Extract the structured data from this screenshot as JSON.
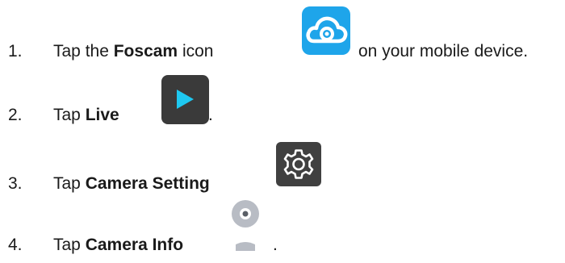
{
  "steps": [
    {
      "number": "1.",
      "prefix": "Tap the ",
      "bold": "Foscam",
      "suffix": " icon",
      "after_icon": "on your mobile device.",
      "icon": "foscam-cloud-app-icon"
    },
    {
      "number": "2.",
      "prefix": "Tap ",
      "bold": "Live",
      "after_icon": ".",
      "icon": "play-icon"
    },
    {
      "number": "3.",
      "prefix": "Tap ",
      "bold": "Camera Setting",
      "icon": "gear-icon"
    },
    {
      "number": "4.",
      "prefix": "Tap ",
      "bold": "Camera Info",
      "after_icon": ".",
      "icon": "camera-icon"
    }
  ],
  "colors": {
    "text": "#1a1a1a",
    "foscam_blue": "#1ea5ea",
    "live_bg": "#3a3a3a",
    "play_cyan": "#1ec8f0",
    "gear_bg": "#404040",
    "camera_gray": "#b8bcc4"
  }
}
